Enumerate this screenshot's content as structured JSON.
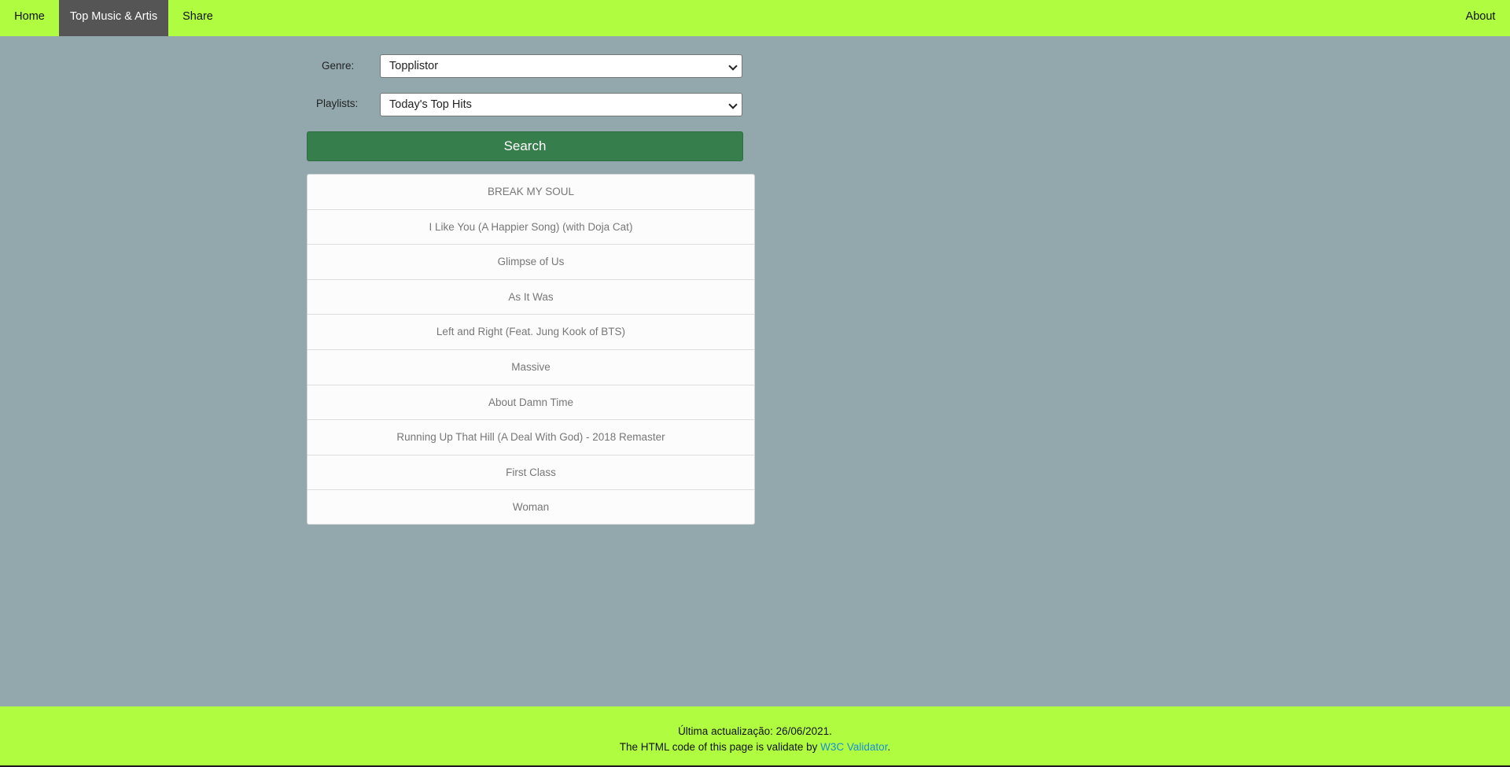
{
  "nav": {
    "home": "Home",
    "top_music": "Top Music & Artis",
    "share": "Share",
    "about": "About"
  },
  "form": {
    "genre_label": "Genre:",
    "genre_value": "Topplistor",
    "playlists_label": "Playlists:",
    "playlist_value": "Today's Top Hits",
    "search_label": "Search"
  },
  "results": [
    "BREAK MY SOUL",
    "I Like You (A Happier Song) (with Doja Cat)",
    "Glimpse of Us",
    "As It Was",
    "Left and Right (Feat. Jung Kook of BTS)",
    "Massive",
    "About Damn Time",
    "Running Up That Hill (A Deal With God) - 2018 Remaster",
    "First Class",
    "Woman"
  ],
  "footer": {
    "updated": "Última actualização: 26/06/2021.",
    "validate_prefix": "The HTML code of this page is validate by ",
    "validator_link": "W3C Validator",
    "validate_suffix": "."
  },
  "colors": {
    "nav_bg": "#b0fc40",
    "active_tab_bg": "#555555",
    "page_bg": "#93a8ac",
    "search_btn": "#377e4d",
    "link": "#1a8fd8"
  }
}
